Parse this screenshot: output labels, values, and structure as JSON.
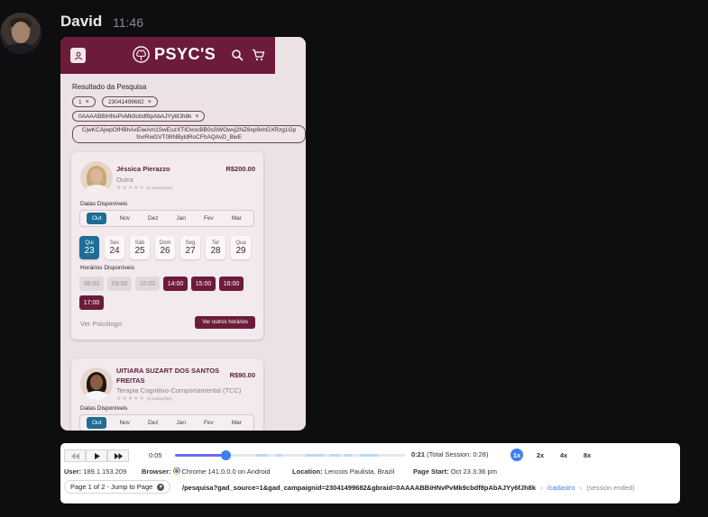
{
  "chat": {
    "user_name": "David",
    "time": "11:46"
  },
  "app": {
    "logo_text": "PSYC'S",
    "results_title": "Resultado da Pesquisa",
    "filters": [
      "1",
      "23041499682",
      "0AAAABBiHNvPvMk9cbdf8pAbAJYy6fJh8k",
      "CjwKCAjwpOfHBhAxEiwAm1SwEuzXTIOxocBB0sSWOwvj2NZ6xp9xhGXRzg1Gp",
      "SvrRwGVT0BNByldRoCFhAQAvD_BwE"
    ],
    "filter_remove_glyph": "×",
    "card1": {
      "name": "Jéssica Pierazzo",
      "price": "R$200.00",
      "specialty": "Outra",
      "stars": "★★★★★",
      "reviews": "(0 avaliações)",
      "dates_label": "Datas Disponíveis",
      "months": [
        "Out",
        "Nov",
        "Dez",
        "Jan",
        "Fev",
        "Mar"
      ],
      "days": [
        {
          "name": "Qui",
          "num": "23"
        },
        {
          "name": "Sex",
          "num": "24"
        },
        {
          "name": "Sáb",
          "num": "25"
        },
        {
          "name": "Dom",
          "num": "26"
        },
        {
          "name": "Seg",
          "num": "27"
        },
        {
          "name": "Ter",
          "num": "28"
        },
        {
          "name": "Qua",
          "num": "29"
        }
      ],
      "times_label": "Horários Disponíveis",
      "times": [
        "08:00",
        "09:00",
        "10:00",
        "14:00",
        "15:00",
        "16:00",
        "17:00"
      ],
      "see_psychologist": "Ver Psicólogo",
      "other_times_button": "Ver outros horários"
    },
    "card2": {
      "name": "UITIARA SUZART DOS SANTOS FREITAS",
      "price": "R$90.00",
      "specialty": "Terapia Cognitivo-Comportamental (TCC)",
      "stars": "★★★★★",
      "reviews": "(0 avaliações)",
      "dates_label": "Datas Disponíveis",
      "months": [
        "Out",
        "Nov",
        "Dez",
        "Jan",
        "Fev",
        "Mar"
      ]
    }
  },
  "player": {
    "current_time": "0:05",
    "progress": 0.22,
    "end_time": "0:21",
    "total_session": "(Total Session: 0:28)",
    "speeds": [
      "1x",
      "2x",
      "4x",
      "8x"
    ],
    "active_speed": "1x",
    "user_label": "User:",
    "user_value": "189.1.153.209",
    "browser_label": "Browser:",
    "browser_value": "Chrome 141.0.0.0 on Android",
    "location_label": "Location:",
    "location_value": "Lencois Paulista, Brazil",
    "page_start_label": "Page Start:",
    "page_start_value": "Oct 23 3:36 pm",
    "pager": "Page 1 of 2 - Jump to Page",
    "current_path": "/pesquisa?gad_source=1&gad_campaignid=23041499682&gbraid=0AAAABBiHNvPvMk9cbdf8pAbAJYy6fJh8k",
    "next_path": "/cadastro",
    "ended": "(session ended)",
    "separator": "›"
  },
  "colors": {
    "brand": "#6c1b3b",
    "accent_blue": "#1d6d94",
    "player_blue": "#3d7ff0"
  }
}
